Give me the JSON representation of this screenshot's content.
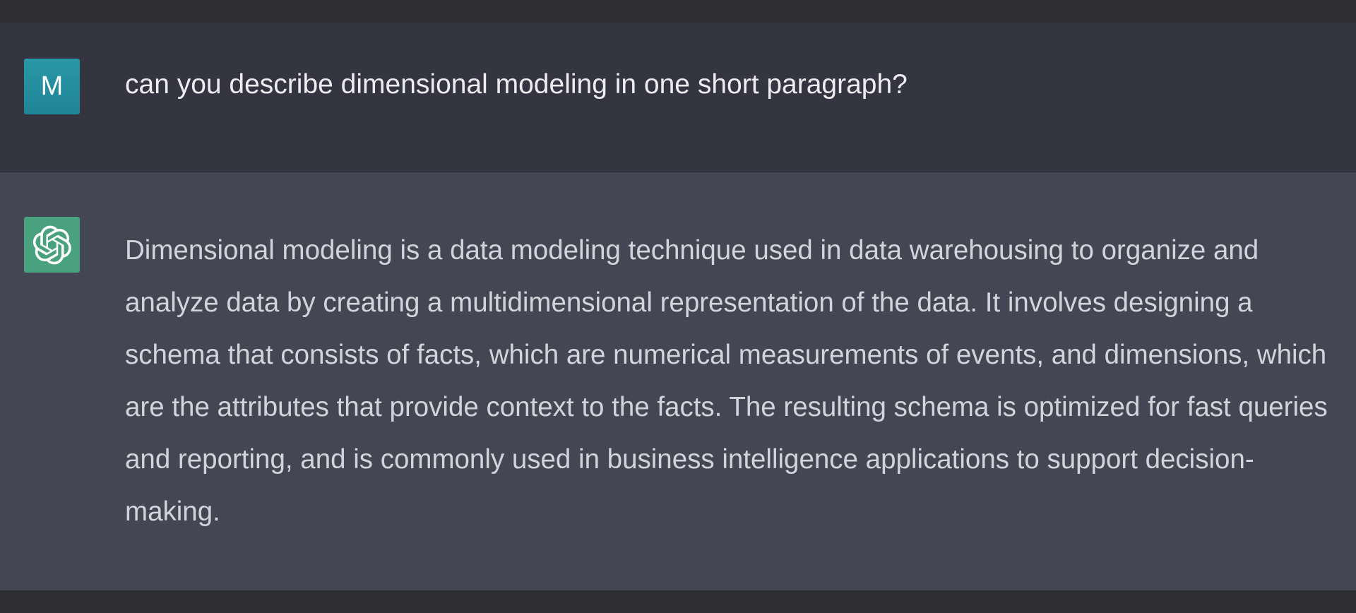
{
  "conversation": {
    "user_message": {
      "avatar_initial": "M",
      "text": "can you describe dimensional modeling in one short paragraph?"
    },
    "assistant_message": {
      "avatar_icon": "openai-logo-icon",
      "text": "Dimensional modeling is a data modeling technique used in data warehousing to organize and analyze data by creating a multidimensional representation of the data. It involves designing a schema that consists of facts, which are numerical measurements of events, and dimensions, which are the attributes that provide context to the facts. The resulting schema is optimized for fast queries and reporting, and is commonly used in business intelligence applications to support decision-making."
    }
  },
  "colors": {
    "user_row_bg": "#343541",
    "assistant_row_bg": "#444654",
    "user_avatar_bg": "#1f8597",
    "assistant_avatar_bg": "#4aa180",
    "user_text": "#ececf1",
    "assistant_text": "#d1d5db"
  }
}
